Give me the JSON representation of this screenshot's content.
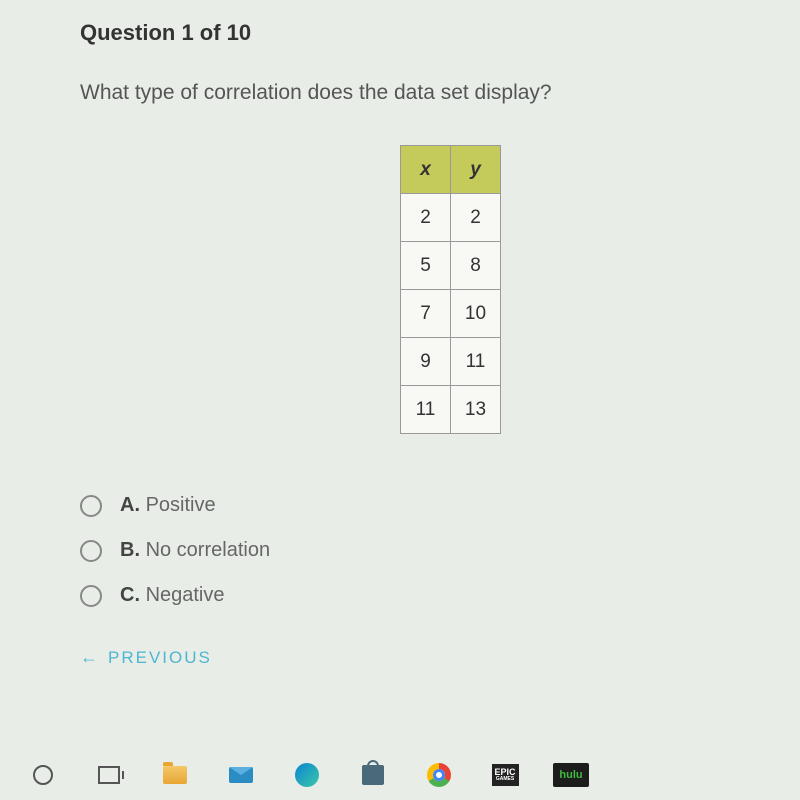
{
  "header": "Question 1 of 10",
  "question": "What type of correlation does the data set display?",
  "table": {
    "headers": [
      "x",
      "y"
    ],
    "rows": [
      [
        "2",
        "2"
      ],
      [
        "5",
        "8"
      ],
      [
        "7",
        "10"
      ],
      [
        "9",
        "11"
      ],
      [
        "11",
        "13"
      ]
    ]
  },
  "options": [
    {
      "letter": "A.",
      "text": "Positive"
    },
    {
      "letter": "B.",
      "text": "No correlation"
    },
    {
      "letter": "C.",
      "text": "Negative"
    }
  ],
  "previous": "PREVIOUS",
  "taskbar": {
    "epic": "EPIC",
    "epic_sub": "GAMES",
    "hulu": "hulu"
  }
}
